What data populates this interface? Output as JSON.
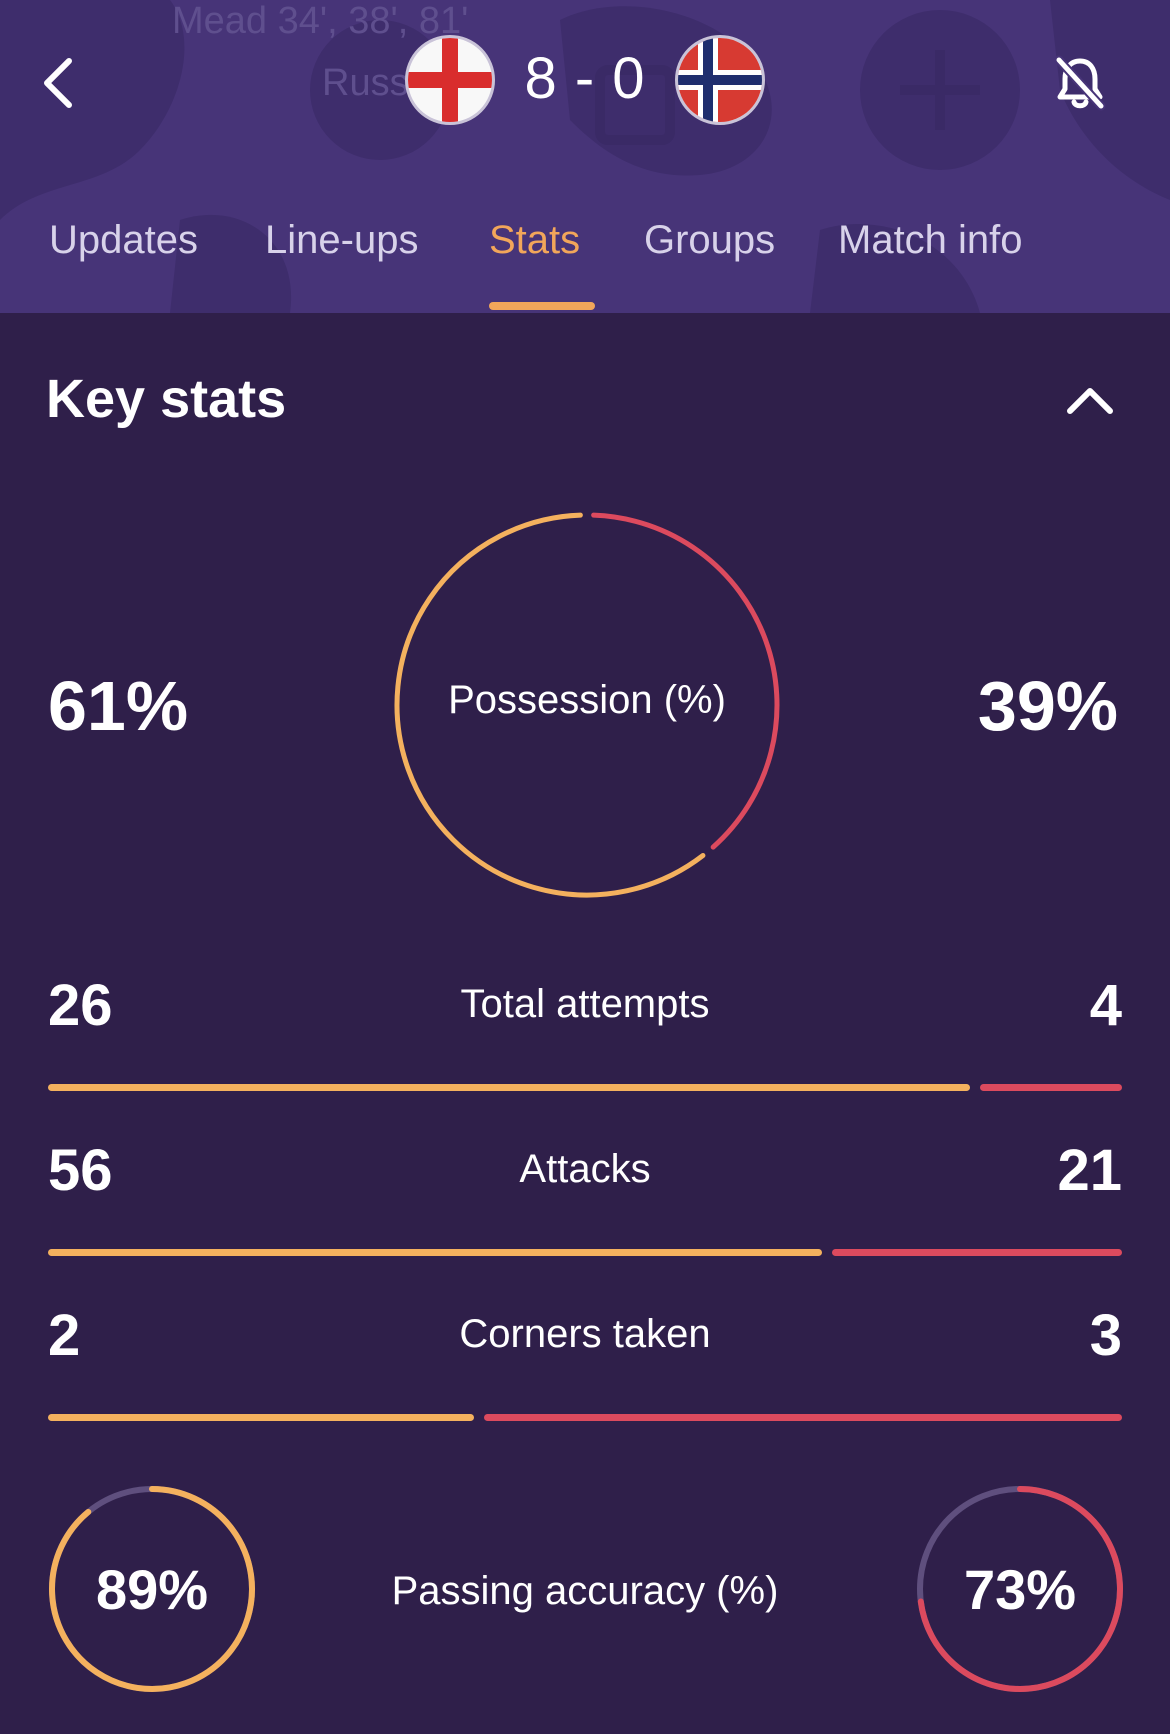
{
  "header": {
    "ghost_texts": [
      "Mead 34', 38', 81'",
      "Russo"
    ],
    "score": "8 - 0",
    "home_flag_icon": "england-flag-icon",
    "away_flag_icon": "norway-flag-icon",
    "back_icon": "chevron-left-icon",
    "notify_icon": "bell-off-icon"
  },
  "tabs": [
    {
      "label": "Updates"
    },
    {
      "label": "Line-ups"
    },
    {
      "label": "Stats",
      "active": true
    },
    {
      "label": "Groups"
    },
    {
      "label": "Match info"
    }
  ],
  "key_stats": {
    "title": "Key stats",
    "collapse_icon": "chevron-up-icon",
    "possession": {
      "label": "Possession (%)",
      "home": "61%",
      "away": "39%",
      "home_value": 61,
      "away_value": 39
    },
    "rows": [
      {
        "label": "Total attempts",
        "home": "26",
        "away": "4",
        "home_value": 26,
        "away_value": 4
      },
      {
        "label": "Attacks",
        "home": "56",
        "away": "21",
        "home_value": 56,
        "away_value": 21
      },
      {
        "label": "Corners taken",
        "home": "2",
        "away": "3",
        "home_value": 2,
        "away_value": 3
      }
    ],
    "passing": {
      "label": "Passing accuracy (%)",
      "home": "89%",
      "away": "73%",
      "home_value": 89,
      "away_value": 73
    }
  },
  "colors": {
    "home": "#f4b15e",
    "away": "#dc4a5e",
    "ring_track": "#5f4f7e",
    "tab_active": "#f2a65a",
    "background": "#2f1f4a",
    "header_background": "#473478"
  }
}
